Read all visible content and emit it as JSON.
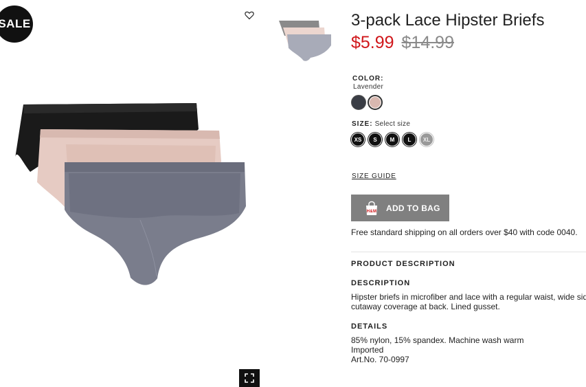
{
  "badge": {
    "label": "SALE"
  },
  "product": {
    "title": "3-pack Lace Hipster Briefs",
    "price_new": "$5.99",
    "price_old": "$14.99"
  },
  "color": {
    "label": "COLOR:",
    "selected": "Lavender",
    "swatches": [
      {
        "name": "dark grey",
        "hex": "#3a3d45"
      },
      {
        "name": "light pink",
        "hex": "#d9b8b0"
      }
    ]
  },
  "size": {
    "label": "SIZE:",
    "hint": "Select size",
    "options": [
      "XS",
      "S",
      "M",
      "L",
      "XL"
    ]
  },
  "size_guide": "SIZE GUIDE",
  "add_to_bag": "ADD TO BAG",
  "shipping": "Free standard shipping on all orders over $40 with code 0040.",
  "product_description": {
    "heading": "PRODUCT DESCRIPTION",
    "description_heading": "DESCRIPTION",
    "description_line1": "Hipster briefs in microfiber and lace with a regular waist, wide side",
    "description_line2": "cutaway coverage at back. Lined gusset.",
    "details_heading": "DETAILS",
    "details_line1": "85% nylon, 15% spandex. Machine wash warm",
    "details_line2": "Imported",
    "details_line3": "Art.No. 70-0997"
  },
  "colors": {
    "sale_red": "#d0171b",
    "button_grey": "#808080",
    "badge_black": "#111111"
  },
  "icons": {
    "favorite": "heart-icon",
    "expand": "expand-icon",
    "bag": "shopping-bag-icon"
  }
}
